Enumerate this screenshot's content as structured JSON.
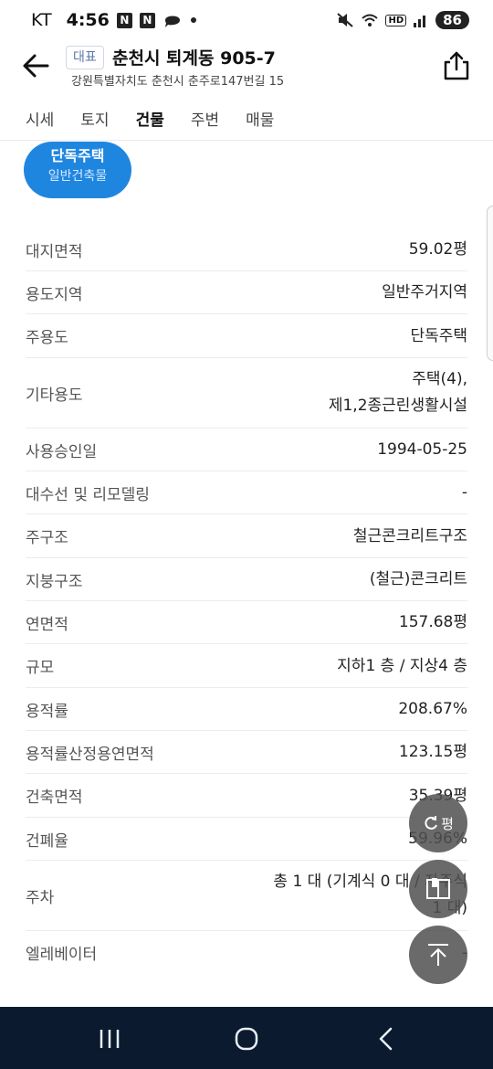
{
  "status": {
    "carrier": "KT",
    "time": "4:56",
    "badges": [
      "N",
      "N"
    ],
    "battery": "86",
    "hd_label": "HD"
  },
  "header": {
    "tag": "대표",
    "title": "춘천시 퇴계동 905-7",
    "address": "강원특별자치도 춘천시 춘주로147번길 15"
  },
  "tabs": [
    {
      "label": "시세"
    },
    {
      "label": "토지"
    },
    {
      "label": "건물"
    },
    {
      "label": "주변"
    },
    {
      "label": "매물"
    }
  ],
  "building_pill": {
    "type": "단독주택",
    "sub": "일반건축물"
  },
  "details": [
    {
      "label": "대지면적",
      "value": "59.02평"
    },
    {
      "label": "용도지역",
      "value": "일반주거지역"
    },
    {
      "label": "주용도",
      "value": "단독주택"
    },
    {
      "label": "기타용도",
      "value": "주택(4),",
      "value2": "제1,2종근린생활시설"
    },
    {
      "label": "사용승인일",
      "value": "1994-05-25"
    },
    {
      "label": "대수선 및 리모델링",
      "value": "-"
    },
    {
      "label": "주구조",
      "value": "철근콘크리트구조"
    },
    {
      "label": "지붕구조",
      "value": "(철근)콘크리트"
    },
    {
      "label": "연면적",
      "value": "157.68평"
    },
    {
      "label": "규모",
      "value": "지하1 층 / 지상4 층"
    },
    {
      "label": "용적률",
      "value": "208.67%"
    },
    {
      "label": "용적률산정용연면적",
      "value": "123.15평"
    },
    {
      "label": "건축면적",
      "value": "35.39평"
    },
    {
      "label": "건폐율",
      "value": "59.96%"
    },
    {
      "label": "주차",
      "value": "총 1 대 (기계식 0 대 / 자주식",
      "value2": "1 대)"
    },
    {
      "label": "엘레베이터",
      "value": "-"
    }
  ],
  "fab": {
    "unit_label": "평"
  }
}
